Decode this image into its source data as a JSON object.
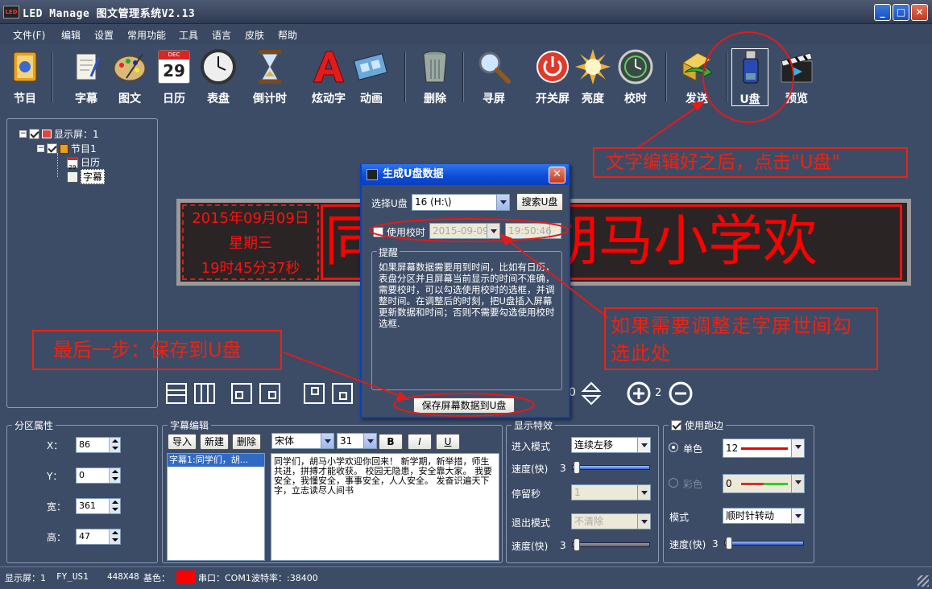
{
  "window": {
    "title": "LED Manage 图文管理系统V2.13",
    "app_icon_text": "LED",
    "min": "_",
    "max": "□",
    "close": "✕"
  },
  "menu": [
    "文件(F)",
    "编辑",
    "设置",
    "常用功能",
    "工具",
    "语言",
    "皮肤",
    "帮助"
  ],
  "toolbar": [
    {
      "label": "节目",
      "icon": "book-icon"
    },
    {
      "label": "字幕",
      "icon": "scroll-icon"
    },
    {
      "label": "图文",
      "icon": "palette-icon"
    },
    {
      "label": "日历",
      "icon": "calendar-icon",
      "day": "29",
      "month": "DEC"
    },
    {
      "label": "表盘",
      "icon": "clock-icon"
    },
    {
      "label": "倒计时",
      "icon": "hourglass-icon"
    },
    {
      "label": "炫动字",
      "icon": "letter-a-icon"
    },
    {
      "label": "动画",
      "icon": "film-icon"
    },
    {
      "label": "删除",
      "icon": "trash-icon"
    },
    {
      "label": "寻屏",
      "icon": "magnifier-icon"
    },
    {
      "label": "开关屏",
      "icon": "power-icon"
    },
    {
      "label": "亮度",
      "icon": "sun-icon"
    },
    {
      "label": "校时",
      "icon": "time-sync-icon"
    },
    {
      "label": "发送",
      "icon": "send-icon"
    },
    {
      "label": "U盘",
      "icon": "usb-icon"
    },
    {
      "label": "预览",
      "icon": "clapper-icon"
    }
  ],
  "tree": {
    "screen": "显示屏：1",
    "program": "节目1",
    "items": [
      "日历",
      "字幕"
    ],
    "calendar_day": "29"
  },
  "led": {
    "date": "2015年09月09日",
    "weekday": "星期三",
    "time": "19时45分37秒",
    "scroll_text": "同学们，胡马小学欢"
  },
  "dialog": {
    "title": "生成U盘数据",
    "select_label": "选择U盘",
    "drive": "16 (H:\\)",
    "search_button": "搜索U盘",
    "use_time_label": "使用校时",
    "date": "2015-09-09",
    "time": "19:50:46",
    "tip_legend": "提醒",
    "tip_text": "如果屏幕数据需要用到时间，比如有日历，表盘分区并且屏幕当前显示的时间不准确，需要校时，可以勾选使用校时的选框，并调整时间。在调整后的时刻，把U盘插入屏幕更新数据和时间；否则不需要勾选使用校时选框.",
    "save_button": "保存屏幕数据到U盘"
  },
  "annotations": {
    "top": "文字编辑好之后，点击\"U盘\"",
    "middle": "如果需要调整走字屏世间勾选此处",
    "left": "最后一步：保存到U盘"
  },
  "zoom": {
    "value": "2",
    "extra": "0"
  },
  "partition": {
    "legend": "分区属性",
    "x_label": "X：",
    "x": "86",
    "y_label": "Y：",
    "y": "0",
    "w_label": "宽：",
    "w": "361",
    "h_label": "高：",
    "h": "47"
  },
  "subtitle": {
    "legend": "字幕编辑",
    "import": "导入",
    "new": "新建",
    "delete": "删除",
    "font": "宋体",
    "size": "31",
    "bold": "B",
    "italic": "I",
    "underline": "U",
    "list_item": "字幕1:同学们，胡...",
    "text": "同学们，胡马小学欢迎你回来！   新学期，新举措，师生共进，拼搏才能收获。   校园无隐患，安全靠大家。   我要安全，我懂安全，事事安全，人人安全。   发奋识遍天下字，立志读尽人间书"
  },
  "effect": {
    "legend": "显示特效",
    "enter_label": "进入模式",
    "enter": "连续左移",
    "speed_label": "速度(快)",
    "speed1": "3",
    "speed1_fraction": 0.02,
    "stay_label": "停留秒",
    "stay": "1",
    "exit_label": "退出模式",
    "exit": "不清除",
    "speed2": "3",
    "speed2_fraction": 0.02
  },
  "border": {
    "legend": "使用跑边",
    "single_label": "单色",
    "single": "12",
    "multi_label": "彩色",
    "multi": "0",
    "mode_label": "模式",
    "mode": "顺时针转动",
    "speed_label": "速度(快)",
    "speed": "3",
    "speed_fraction": 0.02
  },
  "status": {
    "screen": "显示屏：1",
    "model": "FY_US1",
    "size": "448X48",
    "color_label": "基色：",
    "port": "串口：COM1",
    "baud": "波特率：:38400"
  },
  "colors": {
    "accent": "#ff0000",
    "led_red": "#ff1010",
    "annotation": "#e21b1b",
    "dialog_title": "#0b4bd6"
  }
}
